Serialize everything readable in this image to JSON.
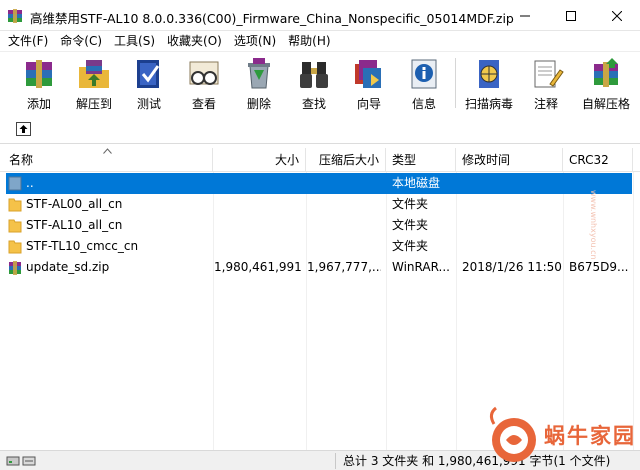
{
  "window": {
    "title": "高维禁用STF-AL10 8.0.0.336(C00)_Firmware_China_Nonspecific_05014MDF.zip"
  },
  "menu": [
    {
      "label": "文件(F)"
    },
    {
      "label": "命令(C)"
    },
    {
      "label": "工具(S)"
    },
    {
      "label": "收藏夹(O)"
    },
    {
      "label": "选项(N)"
    },
    {
      "label": "帮助(H)"
    }
  ],
  "toolbar": [
    {
      "label": "添加",
      "icon": "add-books-icon"
    },
    {
      "label": "解压到",
      "icon": "extract-folder-icon"
    },
    {
      "label": "测试",
      "icon": "test-book-icon"
    },
    {
      "label": "查看",
      "icon": "view-glasses-icon"
    },
    {
      "label": "删除",
      "icon": "delete-recycle-icon"
    },
    {
      "label": "查找",
      "icon": "find-binoculars-icon"
    },
    {
      "label": "向导",
      "icon": "wizard-icon"
    },
    {
      "label": "信息",
      "icon": "info-icon"
    },
    {
      "label": "扫描病毒",
      "icon": "scan-virus-icon"
    },
    {
      "label": "注释",
      "icon": "comment-icon"
    },
    {
      "label": "自解压格",
      "icon": "sfx-icon"
    }
  ],
  "columns": [
    {
      "label": "名称"
    },
    {
      "label": "大小"
    },
    {
      "label": "压缩后大小"
    },
    {
      "label": "类型"
    },
    {
      "label": "修改时间"
    },
    {
      "label": "CRC32"
    }
  ],
  "rows": [
    {
      "name": "..",
      "size": "",
      "packed": "",
      "type": "本地磁盘",
      "modified": "",
      "crc": "",
      "kind": "parent",
      "selected": true
    },
    {
      "name": "STF-AL00_all_cn",
      "size": "",
      "packed": "",
      "type": "文件夹",
      "modified": "",
      "crc": "",
      "kind": "folder"
    },
    {
      "name": "STF-AL10_all_cn",
      "size": "",
      "packed": "",
      "type": "文件夹",
      "modified": "",
      "crc": "",
      "kind": "folder"
    },
    {
      "name": "STF-TL10_cmcc_cn",
      "size": "",
      "packed": "",
      "type": "文件夹",
      "modified": "",
      "crc": "",
      "kind": "folder"
    },
    {
      "name": "update_sd.zip",
      "size": "1,980,461,991",
      "packed": "1,967,777,...",
      "type": "WinRAR...",
      "modified": "2018/1/26 11:50",
      "crc": "B675D9...",
      "kind": "zip"
    }
  ],
  "status": {
    "text": "总计 3 文件夹 和 1,980,461,991 字节(1 个文件)"
  },
  "watermark": {
    "text": "蜗牛家园",
    "url": "www.wnhxyou.cn"
  },
  "colors": {
    "selection": "#0078d7",
    "folder": "#f5c249",
    "watermark": "#e8663a"
  }
}
